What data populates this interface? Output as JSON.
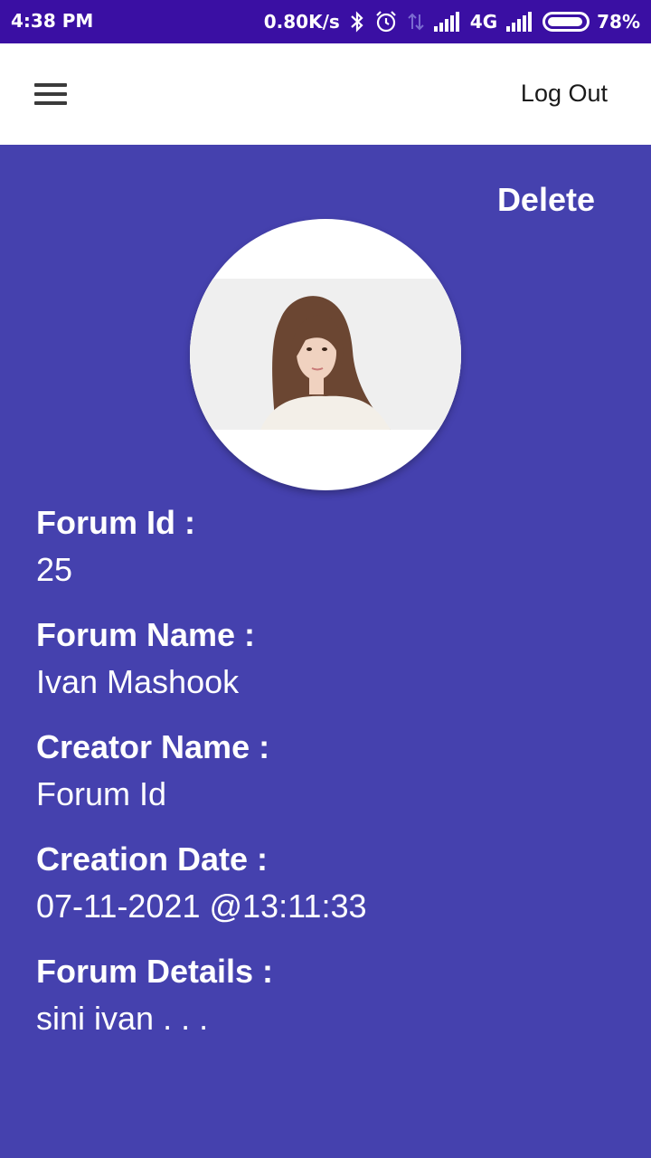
{
  "status_bar": {
    "time": "4:38 PM",
    "speed": "0.80K/s",
    "network": "4G",
    "battery": "78%",
    "icons": [
      "bluetooth-icon",
      "alarm-icon",
      "data-arrows-icon",
      "signal-icon",
      "signal-icon",
      "battery-icon"
    ]
  },
  "app_bar": {
    "logout_label": "Log Out",
    "menu_icon": "hamburger-menu-icon"
  },
  "actions": {
    "delete_label": "Delete"
  },
  "colors": {
    "status_bar": "#3a0fa3",
    "background": "#4541ae",
    "app_bar": "#ffffff",
    "text": "#ffffff"
  },
  "forum": {
    "fields": [
      {
        "label": "Forum Id :",
        "value": "25"
      },
      {
        "label": "Forum Name :",
        "value": "Ivan Mashook"
      },
      {
        "label": "Creator Name :",
        "value": "Forum Id"
      },
      {
        "label": "Creation Date :",
        "value": "07-11-2021 @13:11:33"
      },
      {
        "label": "Forum Details :",
        "value": "sini ivan . . ."
      }
    ]
  }
}
